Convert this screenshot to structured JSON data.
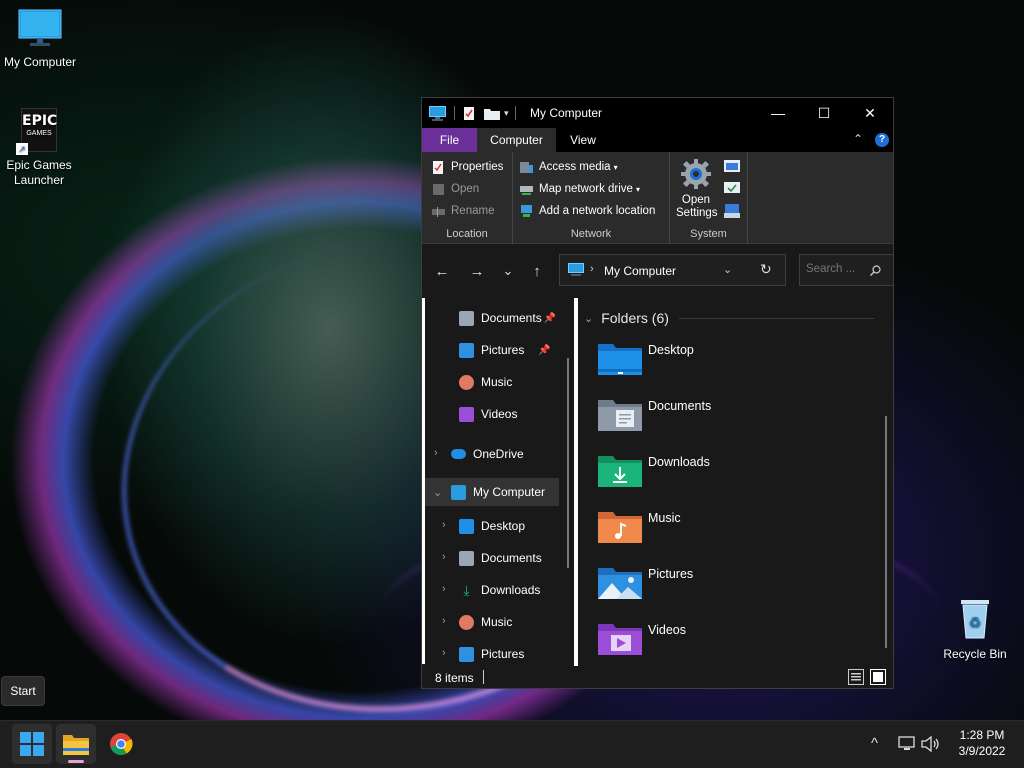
{
  "desktop": {
    "icons": [
      {
        "label": "My Computer"
      },
      {
        "label": "Epic Games Launcher",
        "logo_top": "EPIC",
        "logo_bottom": "GAMES"
      },
      {
        "label": "Recycle Bin"
      }
    ]
  },
  "window": {
    "title": "My Computer",
    "controls": {
      "minimize": "—",
      "maximize": "☐",
      "close": "✕"
    },
    "tabs": [
      {
        "label": "File"
      },
      {
        "label": "Computer"
      },
      {
        "label": "View"
      }
    ],
    "ribbon": {
      "groups": [
        {
          "name": "Location",
          "items": [
            {
              "label": "Properties",
              "enabled": true
            },
            {
              "label": "Open",
              "enabled": false
            },
            {
              "label": "Rename",
              "enabled": false
            }
          ]
        },
        {
          "name": "Network",
          "items": [
            {
              "label": "Access media"
            },
            {
              "label": "Map network drive"
            },
            {
              "label": "Add a network location"
            }
          ]
        },
        {
          "name": "System",
          "items": [
            {
              "label": "Open Settings",
              "line1": "Open",
              "line2": "Settings"
            }
          ]
        }
      ]
    },
    "nav": {
      "back": "←",
      "forward": "→",
      "recent": "⌄",
      "up": "↑",
      "refresh": "↻"
    },
    "address": {
      "path": "My Computer"
    },
    "search": {
      "placeholder": "Search ..."
    },
    "navpane": {
      "items": [
        {
          "label": "Documents",
          "pinned": true
        },
        {
          "label": "Pictures",
          "pinned": true
        },
        {
          "label": "Music"
        },
        {
          "label": "Videos"
        },
        {
          "label": "OneDrive"
        },
        {
          "label": "My Computer",
          "selected": true,
          "expanded": true
        },
        {
          "label": "Desktop"
        },
        {
          "label": "Documents"
        },
        {
          "label": "Downloads"
        },
        {
          "label": "Music"
        },
        {
          "label": "Pictures"
        }
      ]
    },
    "content": {
      "group_header": "Folders (6)",
      "folders": [
        {
          "label": "Desktop",
          "color": "#1e90e8"
        },
        {
          "label": "Documents",
          "color": "#8e9aa8"
        },
        {
          "label": "Downloads",
          "color": "#1bb47a"
        },
        {
          "label": "Music",
          "color": "#f08a4b"
        },
        {
          "label": "Pictures",
          "color": "#2f8fe0"
        },
        {
          "label": "Videos",
          "color": "#9b4fd8"
        }
      ]
    },
    "status": {
      "items_count": "8 items"
    }
  },
  "taskbar": {
    "start_tooltip": "Start",
    "time": "1:28 PM",
    "date": "3/9/2022",
    "tray_chevron": "^"
  },
  "colors": {
    "file_tab": "#6b2f9a",
    "accent_blue": "#1f6fd6"
  }
}
